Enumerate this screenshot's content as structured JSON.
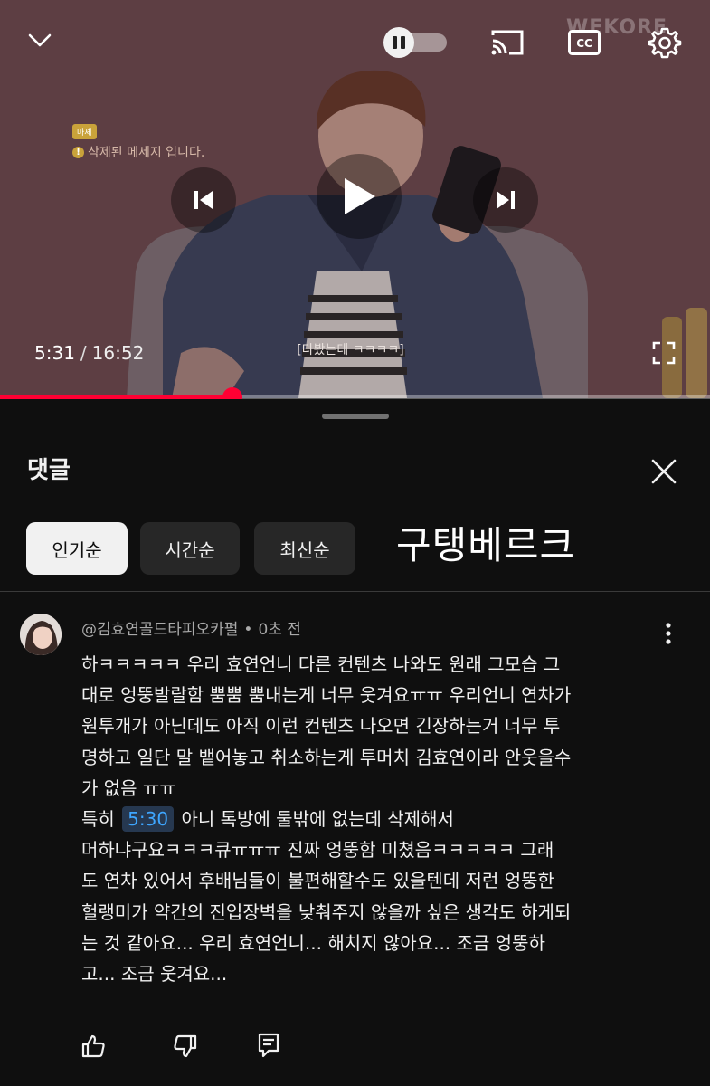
{
  "player": {
    "watermark": "WEKORE",
    "deleted_message": {
      "tag": "마셰",
      "text": "삭제된 메세지 입니다."
    },
    "current_time": "5:31",
    "separator": "/",
    "duration": "16:52",
    "subtitle": "[다봤는데 ㅋㅋㅋㅋ]",
    "progress": 0.328,
    "autoplay_on": false,
    "icons": {
      "collapse": "chevron-down-icon",
      "autoplay": "pause-icon",
      "cast": "cast-icon",
      "captions": "closed-captions-icon",
      "settings": "gear-icon",
      "previous": "skip-previous-icon",
      "play": "play-icon",
      "next": "skip-next-icon",
      "fullscreen": "fullscreen-icon"
    }
  },
  "comments_panel": {
    "title": "댓글",
    "close_icon": "close-icon",
    "sort_chips": [
      {
        "label": "인기순",
        "selected": true
      },
      {
        "label": "시간순",
        "selected": false
      },
      {
        "label": "최신순",
        "selected": false
      }
    ],
    "overlay_label": "구탱베르크",
    "comment": {
      "author": "@김효연골드타피오카펄",
      "time_ago": "0초 전",
      "lines_before": [
        "하ㅋㅋㅋㅋㅋ 우리 효연언니 다른 컨텐츠 나와도 원래 그모습 그",
        "대로 엉뚱발랄함 뿜뿜 뿜내는게 너무 웃겨요ㅠㅠ 우리언니 연차가",
        "원투개가 아닌데도 아직 이런 컨텐츠 나오면 긴장하는거 너무 투",
        "명하고 일단 말 뱉어놓고 취소하는게 투머치 김효연이라 안웃을수",
        "가 없음 ㅠㅠ"
      ],
      "timestamp_prefix": "특히",
      "timestamp": "5:30",
      "timestamp_suffix": "아니 톡방에 둘밖에 없는데 삭제해서",
      "lines_after": [
        "머하냐구요ㅋㅋㅋ큐ㅠㅠㅠ 진짜 엉뚱함 미쳤음ㅋㅋㅋㅋㅋ 그래",
        "도 연차 있어서 후배님들이 불편해할수도 있을텐데 저런 엉뚱한",
        "헐랭미가 약간의 진입장벽을 낮춰주지 않을까 싶은 생각도 하게되",
        "는 것 같아요... 우리 효연언니... 해치지 않아요... 조금 엉뚱하",
        "고... 조금 웃겨요..."
      ]
    },
    "actions": {
      "like_icon": "thumbs-up-icon",
      "dislike_icon": "thumbs-down-icon",
      "reply_icon": "reply-icon",
      "more_icon": "more-vertical-icon"
    },
    "colors": {
      "background": "#0f0f0f",
      "chip_selected": "#f1f1f1",
      "chip": "#272727",
      "progress": "#ff0033",
      "timestamp_link": "#3ea6ff"
    }
  }
}
